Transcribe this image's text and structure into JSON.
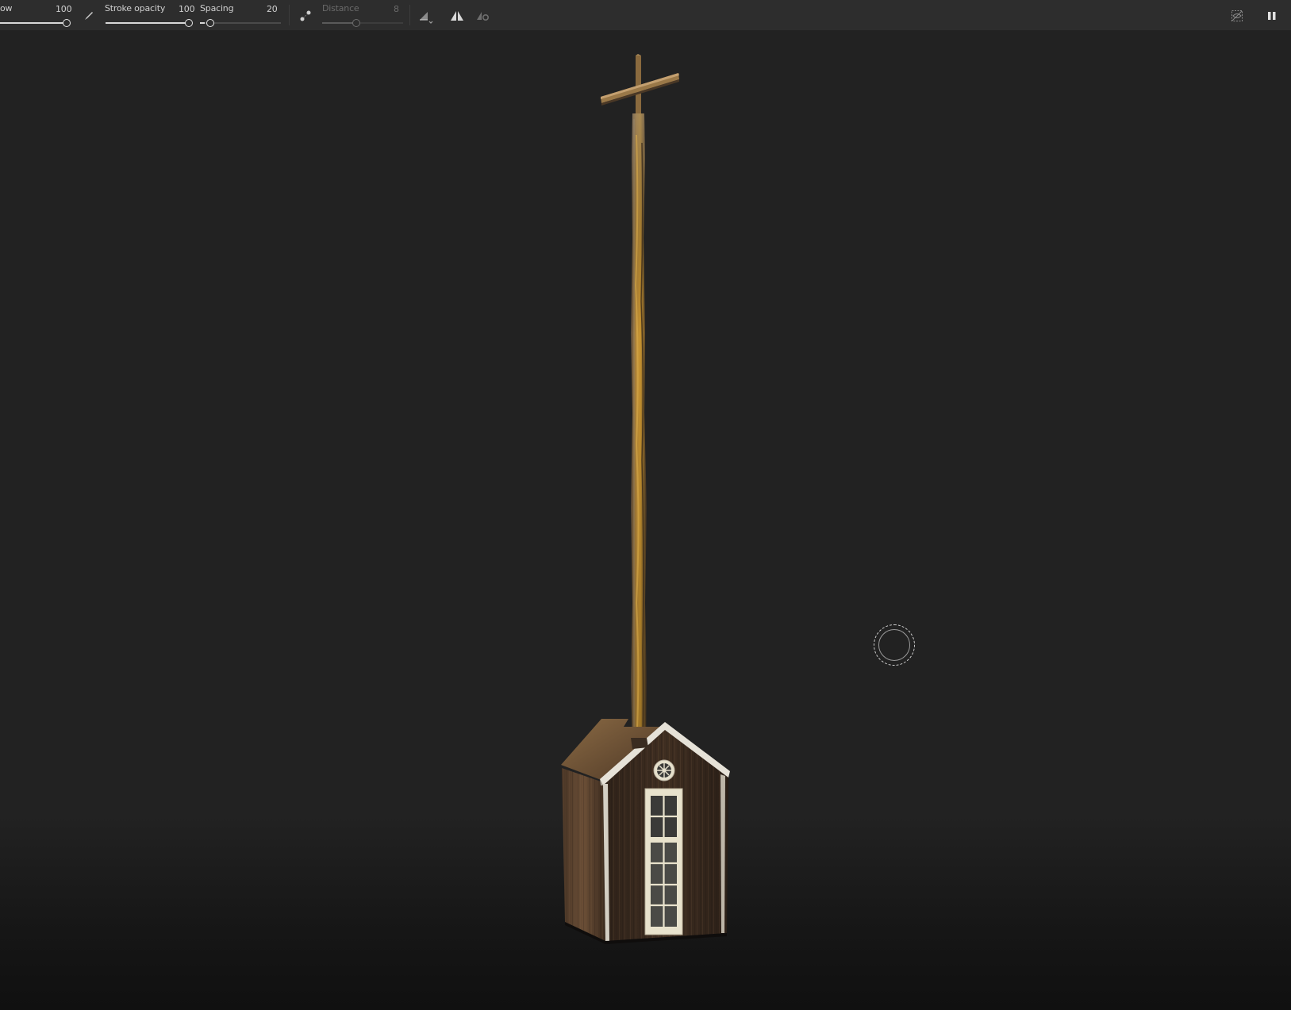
{
  "toolbar": {
    "flow": {
      "label": "ow",
      "value": "100"
    },
    "stroke_opacity": {
      "label": "Stroke opacity",
      "value": "100"
    },
    "spacing": {
      "label": "Spacing",
      "value": "20"
    },
    "distance": {
      "label": "Distance",
      "value": "8"
    },
    "icons": [
      "brush-icon",
      "lazy-mouse-icon",
      "alignment-icon",
      "symmetry-icon",
      "symmetry-settings-icon",
      "hide-selection-icon",
      "pause-icon"
    ]
  },
  "colors": {
    "toolbar_bg": "#2d2d2d",
    "viewport_bg": "#222222",
    "wood_dark": "#3a2a1e",
    "wood_light": "#8a6a44",
    "spire_gold": "#c08a2a",
    "door_cream": "#e6dfc8"
  }
}
